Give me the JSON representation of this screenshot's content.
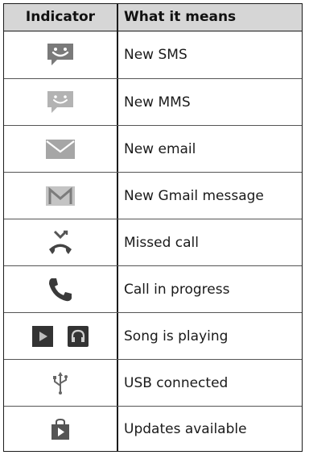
{
  "table": {
    "header": {
      "indicator": "Indicator",
      "meaning": "What it means"
    },
    "rows": [
      {
        "icon": "sms-smile-icon",
        "label": "New SMS"
      },
      {
        "icon": "mms-smile-icon",
        "label": "New MMS"
      },
      {
        "icon": "email-envelope-icon",
        "label": "New email"
      },
      {
        "icon": "gmail-icon",
        "label": "New Gmail message"
      },
      {
        "icon": "missed-call-icon",
        "label": "Missed call"
      },
      {
        "icon": "phone-handset-icon",
        "label": "Call in progress"
      },
      {
        "icon": "play-icon",
        "icon2": "headphones-icon",
        "label": "Song is playing"
      },
      {
        "icon": "usb-icon",
        "label": "USB connected"
      },
      {
        "icon": "store-bag-icon",
        "label": "Updates available"
      }
    ]
  }
}
